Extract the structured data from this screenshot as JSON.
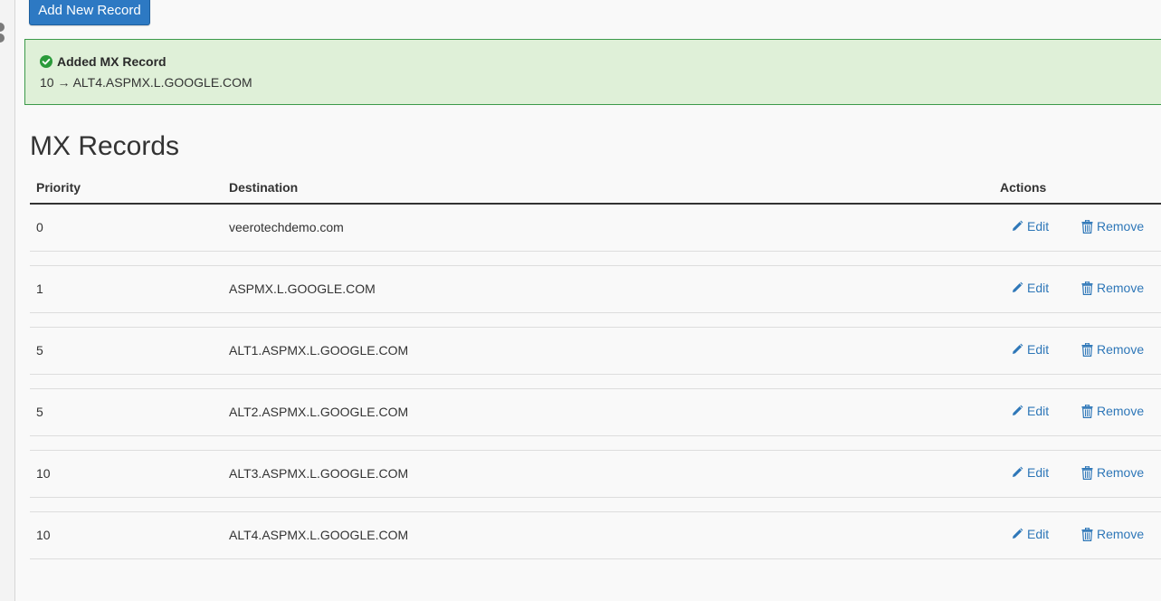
{
  "toolbar": {
    "add_label": "Add New Record"
  },
  "alert": {
    "title": "Added MX Record",
    "message": "10 → ALT4.ASPMX.L.GOOGLE.COM",
    "color": "#dff0d8"
  },
  "section": {
    "title": "MX Records"
  },
  "table": {
    "headers": {
      "priority": "Priority",
      "destination": "Destination",
      "actions": "Actions"
    },
    "edit_label": "Edit",
    "remove_label": "Remove",
    "rows": [
      {
        "priority": "0",
        "destination": "veerotechdemo.com"
      },
      {
        "priority": "1",
        "destination": "ASPMX.L.GOOGLE.COM"
      },
      {
        "priority": "5",
        "destination": "ALT1.ASPMX.L.GOOGLE.COM"
      },
      {
        "priority": "5",
        "destination": "ALT2.ASPMX.L.GOOGLE.COM"
      },
      {
        "priority": "10",
        "destination": "ALT3.ASPMX.L.GOOGLE.COM"
      },
      {
        "priority": "10",
        "destination": "ALT4.ASPMX.L.GOOGLE.COM"
      }
    ]
  },
  "colors": {
    "accent": "#2d79c3",
    "link": "#2e77b8",
    "success": "#3c9a4a"
  },
  "icons": {
    "edit": "pencil-icon",
    "remove": "trash-icon",
    "alert": "check-circle-icon"
  }
}
